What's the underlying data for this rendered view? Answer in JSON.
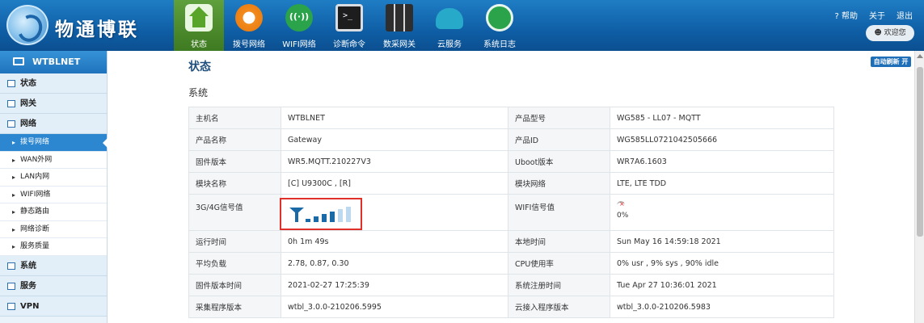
{
  "header": {
    "logo_text": "物通博联",
    "nav": [
      {
        "label": "状态",
        "icon": "home-icon",
        "active": true
      },
      {
        "label": "拨号网络",
        "icon": "dial-icon"
      },
      {
        "label": "WIFI网络",
        "icon": "wifi-icon"
      },
      {
        "label": "诊断命令",
        "icon": "terminal-icon"
      },
      {
        "label": "数采网关",
        "icon": "gateway-icon"
      },
      {
        "label": "云服务",
        "icon": "cloud-icon"
      },
      {
        "label": "系统日志",
        "icon": "log-icon"
      }
    ],
    "links": {
      "help": "? 帮助",
      "about": "关于",
      "logout": "退出"
    },
    "welcome": "欢迎您"
  },
  "sidebar": {
    "title": "WTBLNET",
    "groups": [
      {
        "label": "状态"
      },
      {
        "label": "网关"
      },
      {
        "label": "网络"
      }
    ],
    "sub_items": [
      {
        "label": "拨号网络",
        "active": true
      },
      {
        "label": "WAN外网"
      },
      {
        "label": "LAN内网"
      },
      {
        "label": "WIFI网络"
      },
      {
        "label": "静态路由"
      },
      {
        "label": "网络诊断"
      },
      {
        "label": "服务质量"
      }
    ],
    "groups_after": [
      {
        "label": "系统"
      },
      {
        "label": "服务"
      },
      {
        "label": "VPN"
      }
    ]
  },
  "main": {
    "title": "状态",
    "section": "系统",
    "auto_refresh": "自动刷新 开",
    "rows": [
      {
        "k1": "主机名",
        "v1": "WTBLNET",
        "k2": "产品型号",
        "v2": "WG585 - LL07 - MQTT"
      },
      {
        "k1": "产品名称",
        "v1": "Gateway",
        "k2": "产品ID",
        "v2": "WG585LL0721042505666"
      },
      {
        "k1": "固件版本",
        "v1": "WR5.MQTT.210227V3",
        "k2": "Uboot版本",
        "v2": "WR7A6.1603"
      },
      {
        "k1": "模块名称",
        "v1": "[C] U9300C , [R]",
        "k2": "模块网络",
        "v2": "LTE, LTE TDD"
      },
      {
        "k1": "3G/4G信号值",
        "k2": "WIFI信号值",
        "v2": "0%"
      },
      {
        "k1": "运行时间",
        "v1": "0h 1m 49s",
        "k2": "本地时间",
        "v2": "Sun May 16 14:59:18 2021"
      },
      {
        "k1": "平均负载",
        "v1": "2.78, 0.87, 0.30",
        "k2": "CPU使用率",
        "v2": "0% usr , 9% sys , 90% idle"
      },
      {
        "k1": "固件版本时间",
        "v1": "2021-02-27 17:25:39",
        "k2": "系统注册时间",
        "v2": "Tue Apr 27 10:36:01 2021"
      },
      {
        "k1": "采集程序版本",
        "v1": "wtbl_3.0.0-210206.5995",
        "k2": "云接入程序版本",
        "v2": "wtbl_3.0.0-210206.5983"
      }
    ],
    "signal_bars_total": 6,
    "signal_bars_on": 4
  }
}
